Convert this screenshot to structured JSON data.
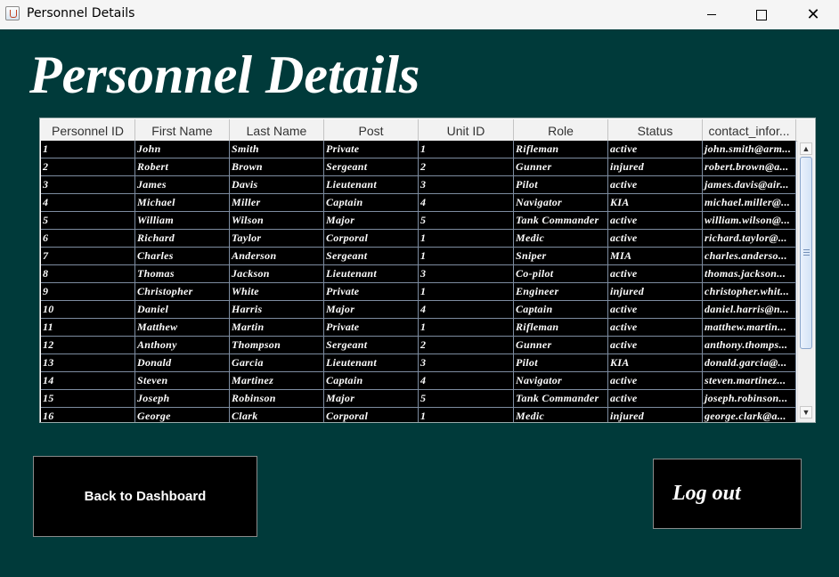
{
  "window": {
    "title": "Personnel Details",
    "icons": {
      "app": "java-cup-icon",
      "minimize": "minimize-icon",
      "maximize": "maximize-icon",
      "close": "close-icon"
    },
    "close_glyph": "✕"
  },
  "page_title": "Personnel Details",
  "table": {
    "columns": [
      "Personnel ID",
      "First Name",
      "Last Name",
      "Post",
      "Unit ID",
      "Role",
      "Status",
      "contact_infor..."
    ],
    "rows": [
      [
        "1",
        "John",
        "Smith",
        "Private",
        "1",
        "Rifleman",
        "active",
        "john.smith@arm..."
      ],
      [
        "2",
        "Robert",
        "Brown",
        "Sergeant",
        "2",
        "Gunner",
        "injured",
        "robert.brown@a..."
      ],
      [
        "3",
        "James",
        "Davis",
        "Lieutenant",
        "3",
        "Pilot",
        "active",
        "james.davis@air..."
      ],
      [
        "4",
        "Michael",
        "Miller",
        "Captain",
        "4",
        "Navigator",
        "KIA",
        "michael.miller@..."
      ],
      [
        "5",
        "William",
        "Wilson",
        "Major",
        "5",
        "Tank Commander",
        "active",
        "william.wilson@..."
      ],
      [
        "6",
        "Richard",
        "Taylor",
        "Corporal",
        "1",
        "Medic",
        "active",
        "richard.taylor@..."
      ],
      [
        "7",
        "Charles",
        "Anderson",
        "Sergeant",
        "1",
        "Sniper",
        "MIA",
        "charles.anderso..."
      ],
      [
        "8",
        "Thomas",
        "Jackson",
        "Lieutenant",
        "3",
        "Co-pilot",
        "active",
        "thomas.jackson..."
      ],
      [
        "9",
        "Christopher",
        "White",
        "Private",
        "1",
        "Engineer",
        "injured",
        "christopher.whit..."
      ],
      [
        "10",
        "Daniel",
        "Harris",
        "Major",
        "4",
        "Captain",
        "active",
        "daniel.harris@n..."
      ],
      [
        "11",
        "Matthew",
        "Martin",
        "Private",
        "1",
        "Rifleman",
        "active",
        "matthew.martin..."
      ],
      [
        "12",
        "Anthony",
        "Thompson",
        "Sergeant",
        "2",
        "Gunner",
        "active",
        "anthony.thomps..."
      ],
      [
        "13",
        "Donald",
        "Garcia",
        "Lieutenant",
        "3",
        "Pilot",
        "KIA",
        "donald.garcia@..."
      ],
      [
        "14",
        "Steven",
        "Martinez",
        "Captain",
        "4",
        "Navigator",
        "active",
        "steven.martinez..."
      ],
      [
        "15",
        "Joseph",
        "Robinson",
        "Major",
        "5",
        "Tank Commander",
        "active",
        "joseph.robinson..."
      ],
      [
        "16",
        "George",
        "Clark",
        "Corporal",
        "1",
        "Medic",
        "injured",
        "george.clark@a..."
      ]
    ]
  },
  "scrollbar": {
    "up_glyph": "▲",
    "down_glyph": "▼",
    "position_fraction": 0.0
  },
  "buttons": {
    "back": "Back to Dashboard",
    "logout": "Log out"
  },
  "colors": {
    "background": "#003a3a",
    "table_body": "#000000",
    "text": "#ffffff"
  }
}
